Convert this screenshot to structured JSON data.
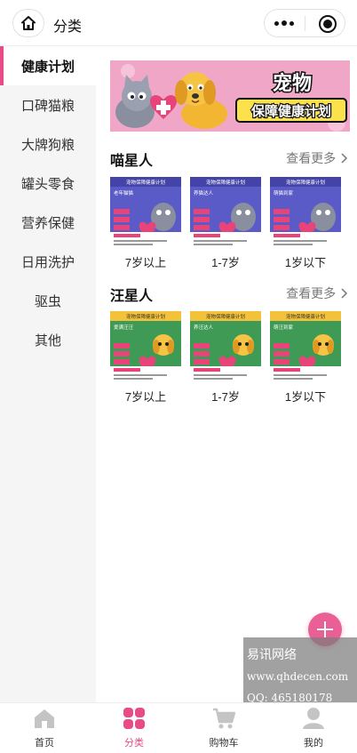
{
  "header": {
    "title": "分类",
    "home_icon": "home-icon",
    "more_icon": "more-dots-icon",
    "close_icon": "target-icon"
  },
  "sidebar": {
    "active_color": "#e84b86",
    "items": [
      {
        "label": "健康计划",
        "active": true
      },
      {
        "label": "口碑猫粮",
        "active": false
      },
      {
        "label": "大牌狗粮",
        "active": false
      },
      {
        "label": "罐头零食",
        "active": false
      },
      {
        "label": "营养保健",
        "active": false
      },
      {
        "label": "日用洗护",
        "active": false
      },
      {
        "label": "驱虫",
        "active": false
      },
      {
        "label": "其他",
        "active": false
      }
    ]
  },
  "banner": {
    "title_line1": "宠物",
    "title_line2": "保障健康计划"
  },
  "sections": [
    {
      "title": "喵星人",
      "more": "查看更多",
      "theme": "#5b5bc8",
      "cards": [
        {
          "label": "7岁以上",
          "heading": "宠物保障健康计划",
          "tag": "老年猫猫"
        },
        {
          "label": "1-7岁",
          "heading": "宠物保障健康计划",
          "tag": "养猫达人"
        },
        {
          "label": "1岁以下",
          "heading": "宠物保障健康计划",
          "tag": "萌猫到家"
        }
      ]
    },
    {
      "title": "汪星人",
      "more": "查看更多",
      "theme": "#3f9a55",
      "cards": [
        {
          "label": "7岁以上",
          "heading": "宠物保障健康计划",
          "tag": "爱满汪汪"
        },
        {
          "label": "1-7岁",
          "heading": "宠物保障健康计划",
          "tag": "养汪达人"
        },
        {
          "label": "1岁以下",
          "heading": "宠物保障健康计划",
          "tag": "萌汪到家"
        }
      ]
    }
  ],
  "watermark": {
    "line1": "易讯网络",
    "line2": "www.qhdecen.com",
    "line3": "QQ: 465180178"
  },
  "tabbar": {
    "active_color": "#e84b86",
    "tabs": [
      {
        "label": "首页",
        "icon": "home-icon",
        "active": false
      },
      {
        "label": "分类",
        "icon": "category-icon",
        "active": true
      },
      {
        "label": "购物车",
        "icon": "cart-icon",
        "active": false
      },
      {
        "label": "我的",
        "icon": "user-icon",
        "active": false
      }
    ]
  },
  "fab": {
    "icon": "plus-icon"
  }
}
